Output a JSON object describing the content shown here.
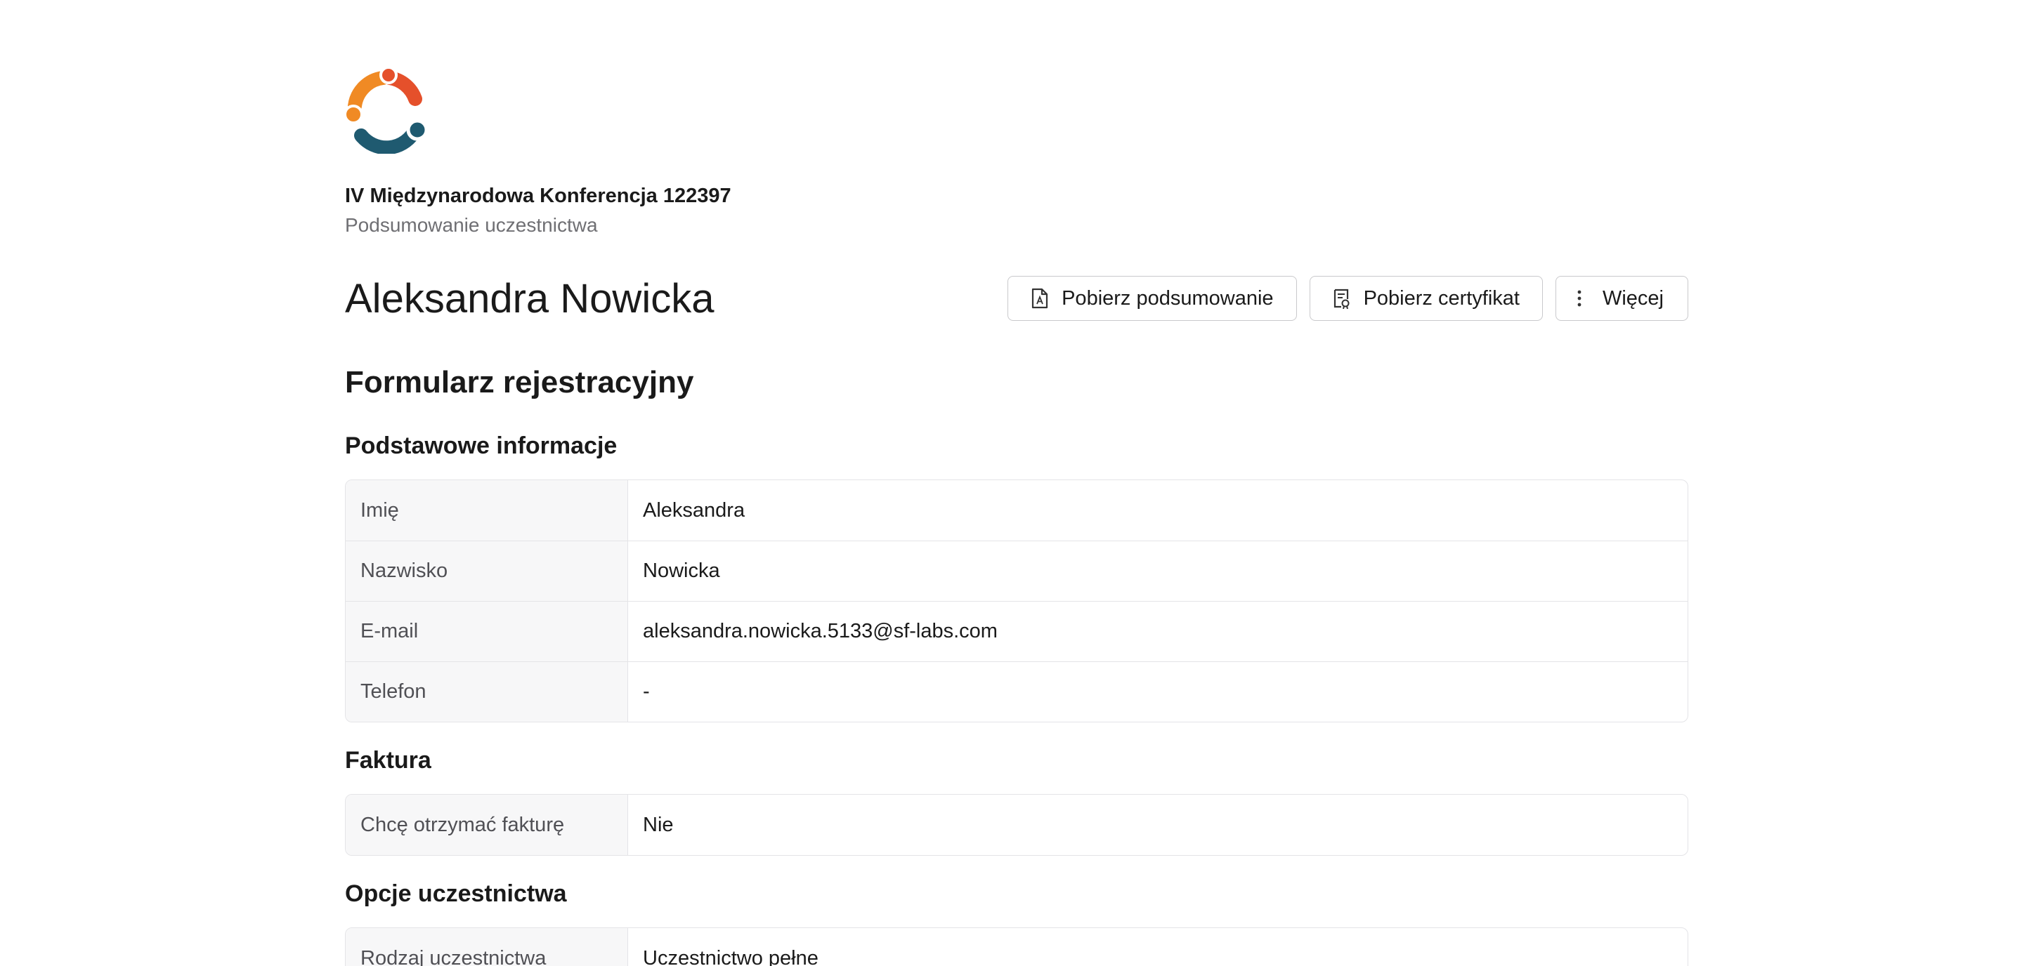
{
  "organization": {
    "title": "IV Międzynarodowa Konferencja 122397",
    "subtitle": "Podsumowanie uczestnictwa",
    "logo_icon": "people-circle-logo",
    "colors": {
      "orange": "#f08a24",
      "red": "#e5502b",
      "teal": "#1f5a70"
    }
  },
  "participant": {
    "name": "Aleksandra Nowicka"
  },
  "actions": {
    "download_summary": {
      "label": "Pobierz podsumowanie",
      "icon": "pdf-file-icon"
    },
    "download_certificate": {
      "label": "Pobierz certyfikat",
      "icon": "certificate-icon"
    },
    "more": {
      "label": "Więcej",
      "icon": "vertical-dots-icon"
    }
  },
  "form": {
    "title": "Formularz rejestracyjny",
    "sections": [
      {
        "title": "Podstawowe informacje",
        "rows": [
          {
            "label": "Imię",
            "value": "Aleksandra"
          },
          {
            "label": "Nazwisko",
            "value": "Nowicka"
          },
          {
            "label": "E-mail",
            "value": "aleksandra.nowicka.5133@sf-labs.com"
          },
          {
            "label": "Telefon",
            "value": "-"
          }
        ]
      },
      {
        "title": "Faktura",
        "rows": [
          {
            "label": "Chcę otrzymać fakturę",
            "value": "Nie"
          }
        ]
      },
      {
        "title": "Opcje uczestnictwa",
        "rows": [
          {
            "label": "Rodzaj uczestnictwa",
            "value": "Uczestnictwo pełne"
          }
        ]
      }
    ]
  }
}
